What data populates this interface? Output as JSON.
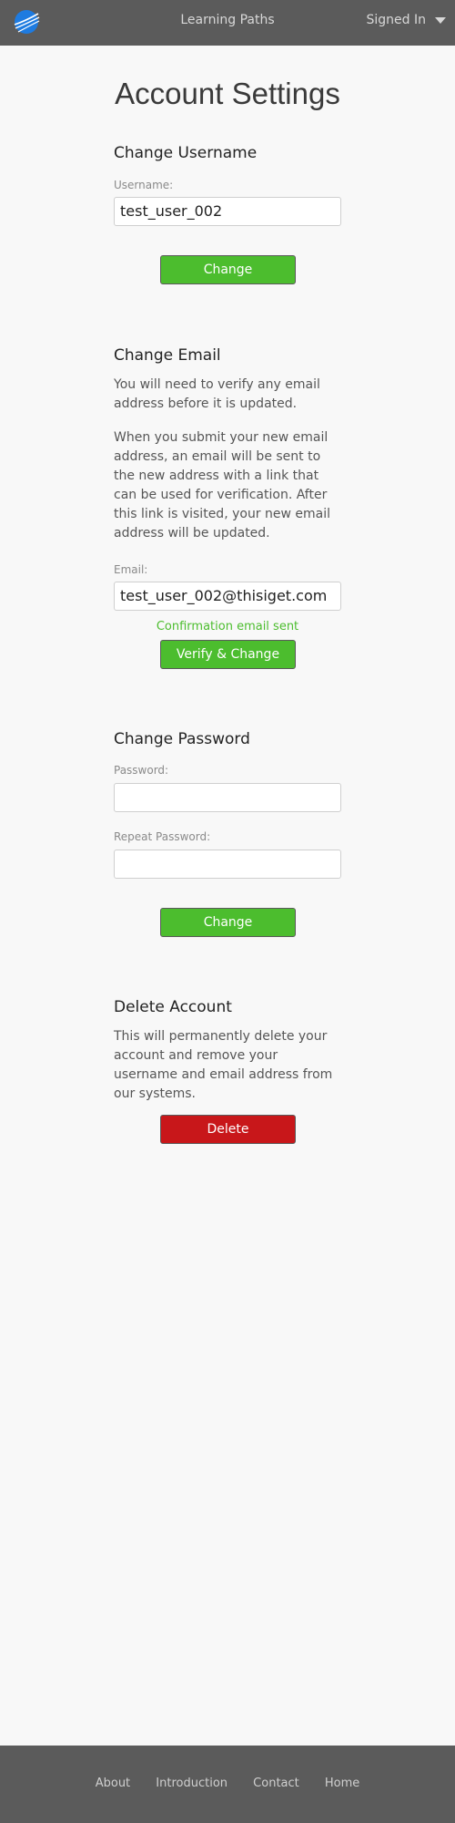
{
  "nav": {
    "title": "Learning Paths",
    "user_menu_label": "Signed In"
  },
  "page": {
    "title": "Account Settings"
  },
  "username_section": {
    "title": "Change Username",
    "label": "Username:",
    "value": "test_user_002",
    "button": "Change"
  },
  "email_section": {
    "title": "Change Email",
    "para1": "You will need to verify any email address before it is updated.",
    "para2": "When you submit your new email address, an email will be sent to the new address with a link that can be used for verification. After this link is visited, your new email address will be updated.",
    "label": "Email:",
    "value": "test_user_002@thisiget.com",
    "status": "Confirmation email sent",
    "button": "Verify & Change"
  },
  "password_section": {
    "title": "Change Password",
    "label": "Password:",
    "value": "",
    "repeat_label": "Repeat Password:",
    "repeat_value": "",
    "button": "Change"
  },
  "delete_section": {
    "title": "Delete Account",
    "para": "This will permanently delete your account and remove your username and email address from our systems.",
    "button": "Delete"
  },
  "footer": {
    "links": [
      "About",
      "Introduction",
      "Contact",
      "Home"
    ]
  },
  "colors": {
    "navbar": "#5b5b5b",
    "success_green": "#4cbd2e",
    "danger_red": "#c8171a",
    "background": "#f8f8f8"
  }
}
